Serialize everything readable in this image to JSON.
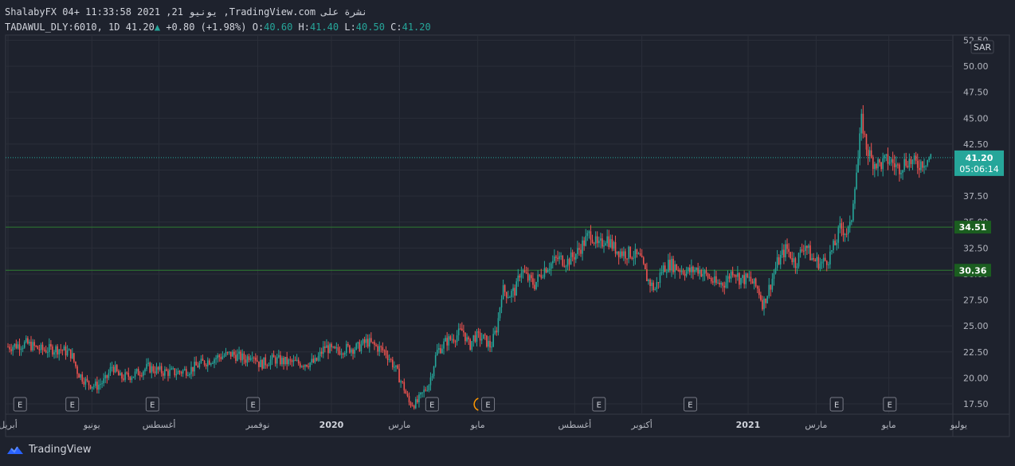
{
  "header": {
    "line1": "ShalabyFX 04+ 11:33:58 2021 ,21 يونيو ,TradingView.com نشرة على",
    "symbol": "TADAWUL_DLY:6010, 1D",
    "last": "41.20",
    "change": "+0.80 (+1.98%)",
    "o_label": "O:",
    "o_val": "40.60",
    "h_label": "H:",
    "h_val": "41.40",
    "l_label": "L:",
    "l_val": "40.50",
    "c_label": "C:",
    "c_val": "41.20"
  },
  "currency_badge": "SAR",
  "price_tag": {
    "price": "41.20",
    "countdown": "05:06:14",
    "color": "#26a69a"
  },
  "levels": [
    {
      "value": 34.51,
      "label": "34.51",
      "color": "#2e7d32"
    },
    {
      "value": 30.36,
      "label": "30.36",
      "color": "#2e7d32"
    }
  ],
  "footer": {
    "brand": "TradingView"
  },
  "chart_data": {
    "type": "candlestick",
    "ylim": [
      16.5,
      53
    ],
    "y_ticks": [
      17.5,
      20.0,
      22.5,
      25.0,
      27.5,
      30.0,
      32.5,
      35.0,
      37.5,
      40.0,
      42.5,
      45.0,
      47.5,
      50.0,
      52.5
    ],
    "y_tick_labels": [
      "17.50",
      "20.00",
      "22.50",
      "25.00",
      "27.50",
      "30.00",
      "32.50",
      "35.00",
      "37.50",
      "40.00",
      "42.50",
      "45.00",
      "47.50",
      "50.00",
      "52.50"
    ],
    "x_ticks": [
      {
        "label": "أبريل",
        "t": 0.0
      },
      {
        "label": "يونيو",
        "t": 0.09
      },
      {
        "label": "أغسطس",
        "t": 0.162
      },
      {
        "label": "نوفمبر",
        "t": 0.268
      },
      {
        "label": "2020",
        "t": 0.347,
        "bold": true
      },
      {
        "label": "مارس",
        "t": 0.42
      },
      {
        "label": "مايو",
        "t": 0.504
      },
      {
        "label": "أغسطس",
        "t": 0.608
      },
      {
        "label": "أكتوبر",
        "t": 0.68
      },
      {
        "label": "2021",
        "t": 0.794,
        "bold": true
      },
      {
        "label": "مارس",
        "t": 0.867
      },
      {
        "label": "مايو",
        "t": 0.945
      },
      {
        "label": "يوليو",
        "t": 1.02
      }
    ],
    "earnings_markers": [
      {
        "label": "E",
        "t": 0.013
      },
      {
        "label": "E",
        "t": 0.069
      },
      {
        "label": "E",
        "t": 0.155
      },
      {
        "label": "E",
        "t": 0.263
      },
      {
        "label": "E",
        "t": 0.455
      },
      {
        "label": "E",
        "t": 0.515
      },
      {
        "label": "E",
        "t": 0.634
      },
      {
        "label": "E",
        "t": 0.732
      },
      {
        "label": "E",
        "t": 0.889
      },
      {
        "label": "E",
        "t": 0.946
      }
    ],
    "dividend_marker": {
      "t": 0.508
    },
    "last_price": 41.2,
    "bull_color": "#26a69a",
    "bear_color": "#ef5350",
    "path": [
      [
        0.0,
        23.0
      ],
      [
        0.02,
        23.3
      ],
      [
        0.035,
        22.7
      ],
      [
        0.055,
        22.8
      ],
      [
        0.068,
        22.3
      ],
      [
        0.075,
        20.5
      ],
      [
        0.085,
        19.5
      ],
      [
        0.095,
        19.2
      ],
      [
        0.105,
        19.8
      ],
      [
        0.112,
        21.2
      ],
      [
        0.12,
        20.0
      ],
      [
        0.135,
        20.3
      ],
      [
        0.15,
        21.0
      ],
      [
        0.165,
        20.6
      ],
      [
        0.18,
        20.5
      ],
      [
        0.195,
        20.8
      ],
      [
        0.21,
        21.5
      ],
      [
        0.225,
        22.0
      ],
      [
        0.24,
        22.3
      ],
      [
        0.255,
        21.8
      ],
      [
        0.262,
        22.5
      ],
      [
        0.27,
        21.3
      ],
      [
        0.285,
        21.8
      ],
      [
        0.3,
        21.5
      ],
      [
        0.315,
        21.4
      ],
      [
        0.33,
        21.5
      ],
      [
        0.34,
        23.0
      ],
      [
        0.35,
        22.5
      ],
      [
        0.36,
        22.8
      ],
      [
        0.375,
        22.9
      ],
      [
        0.385,
        23.5
      ],
      [
        0.395,
        23.0
      ],
      [
        0.405,
        22.5
      ],
      [
        0.415,
        21.0
      ],
      [
        0.425,
        19.0
      ],
      [
        0.43,
        17.6
      ],
      [
        0.438,
        17.5
      ],
      [
        0.445,
        18.5
      ],
      [
        0.452,
        19.5
      ],
      [
        0.46,
        22.5
      ],
      [
        0.47,
        23.5
      ],
      [
        0.48,
        24.0
      ],
      [
        0.488,
        24.6
      ],
      [
        0.495,
        23.0
      ],
      [
        0.5,
        24.0
      ],
      [
        0.51,
        23.8
      ],
      [
        0.518,
        23.0
      ],
      [
        0.525,
        25.0
      ],
      [
        0.53,
        28.5
      ],
      [
        0.538,
        28.0
      ],
      [
        0.545,
        28.5
      ],
      [
        0.55,
        30.5
      ],
      [
        0.558,
        29.5
      ],
      [
        0.565,
        29.0
      ],
      [
        0.575,
        30.5
      ],
      [
        0.59,
        31.5
      ],
      [
        0.6,
        31.2
      ],
      [
        0.61,
        32.0
      ],
      [
        0.62,
        33.3
      ],
      [
        0.625,
        34.0
      ],
      [
        0.633,
        32.5
      ],
      [
        0.642,
        33.6
      ],
      [
        0.65,
        32.5
      ],
      [
        0.66,
        32.0
      ],
      [
        0.668,
        32.0
      ],
      [
        0.678,
        31.5
      ],
      [
        0.686,
        29.5
      ],
      [
        0.694,
        28.5
      ],
      [
        0.702,
        30.5
      ],
      [
        0.71,
        31.0
      ],
      [
        0.72,
        30.5
      ],
      [
        0.73,
        30.2
      ],
      [
        0.74,
        30.5
      ],
      [
        0.75,
        29.8
      ],
      [
        0.76,
        29.0
      ],
      [
        0.77,
        29.2
      ],
      [
        0.778,
        30.5
      ],
      [
        0.785,
        29.5
      ],
      [
        0.795,
        29.5
      ],
      [
        0.805,
        28.5
      ],
      [
        0.81,
        27.0
      ],
      [
        0.818,
        29.0
      ],
      [
        0.825,
        31.0
      ],
      [
        0.835,
        32.5
      ],
      [
        0.845,
        31.0
      ],
      [
        0.855,
        33.0
      ],
      [
        0.862,
        31.5
      ],
      [
        0.872,
        31.0
      ],
      [
        0.88,
        31.5
      ],
      [
        0.888,
        33.0
      ],
      [
        0.893,
        34.5
      ],
      [
        0.9,
        34.0
      ],
      [
        0.904,
        34.5
      ],
      [
        0.908,
        38.5
      ],
      [
        0.912,
        41.0
      ],
      [
        0.916,
        45.0
      ],
      [
        0.92,
        42.5
      ],
      [
        0.926,
        41.0
      ],
      [
        0.935,
        40.5
      ],
      [
        0.945,
        41.0
      ],
      [
        0.955,
        40.2
      ],
      [
        0.965,
        41.0
      ],
      [
        0.975,
        40.5
      ],
      [
        0.985,
        41.0
      ],
      [
        0.99,
        41.2
      ]
    ]
  }
}
